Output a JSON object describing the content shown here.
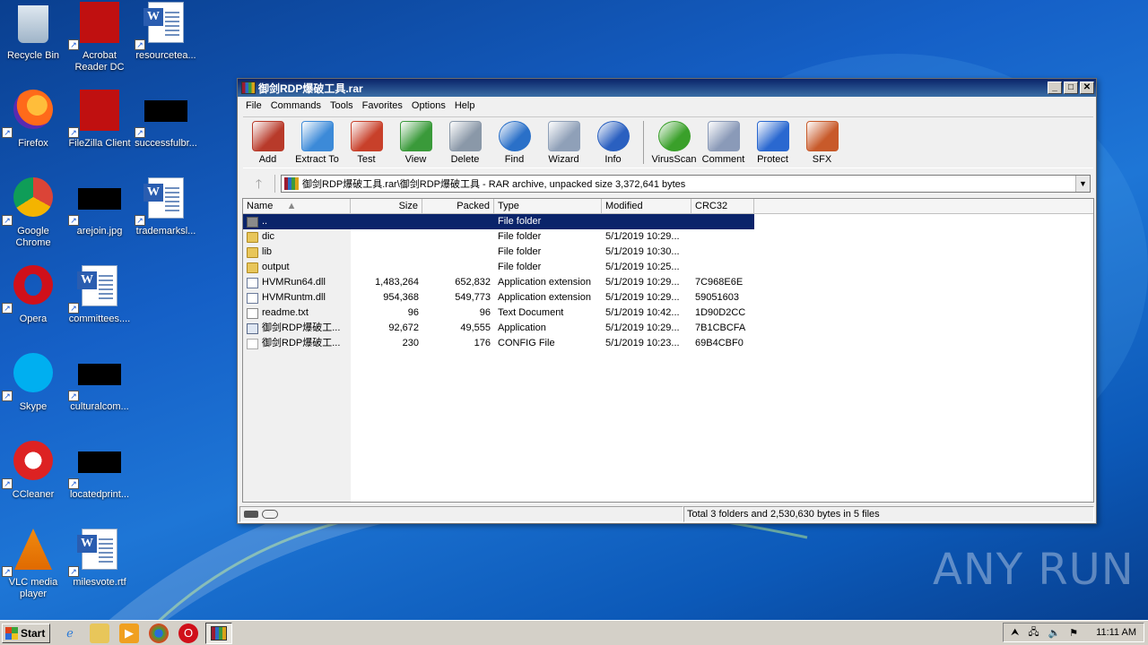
{
  "desktop": {
    "icons": [
      {
        "label": "Recycle Bin"
      },
      {
        "label": "Acrobat Reader DC"
      },
      {
        "label": "resourcetea..."
      },
      {
        "label": "Firefox"
      },
      {
        "label": "FileZilla Client"
      },
      {
        "label": "successfulbr..."
      },
      {
        "label": "Google Chrome"
      },
      {
        "label": "arejoin.jpg"
      },
      {
        "label": "trademarksl..."
      },
      {
        "label": "Opera"
      },
      {
        "label": "committees...."
      },
      {
        "label": "Skype"
      },
      {
        "label": "culturalcom..."
      },
      {
        "label": "CCleaner"
      },
      {
        "label": "locatedprint..."
      },
      {
        "label": "VLC media player"
      },
      {
        "label": "milesvote.rtf"
      }
    ],
    "watermark": "ANY RUN"
  },
  "window": {
    "title": "御剑RDP爆破工具.rar",
    "controls": {
      "min": "_",
      "max": "□",
      "close": "✕"
    },
    "menu": [
      "File",
      "Commands",
      "Tools",
      "Favorites",
      "Options",
      "Help"
    ],
    "toolbar": [
      {
        "label": "Add",
        "color": "#b83a2a"
      },
      {
        "label": "Extract To",
        "color": "#3c8ad8"
      },
      {
        "label": "Test",
        "color": "#c8402a"
      },
      {
        "label": "View",
        "color": "#3a9a3a"
      },
      {
        "label": "Delete",
        "color": "#8a98a8"
      },
      {
        "label": "Find",
        "color": "#2a70c8"
      },
      {
        "label": "Wizard",
        "color": "#8fa0b8"
      },
      {
        "label": "Info",
        "color": "#2a60c0"
      },
      {
        "label": "VirusScan",
        "color": "#3aa02a"
      },
      {
        "label": "Comment",
        "color": "#8a9ab8"
      },
      {
        "label": "Protect",
        "color": "#2a68d0"
      },
      {
        "label": "SFX",
        "color": "#c85a2a"
      }
    ],
    "address": "御剑RDP爆破工具.rar\\御剑RDP爆破工具 - RAR archive, unpacked size 3,372,641 bytes",
    "columns": {
      "name": "Name",
      "size": "Size",
      "packed": "Packed",
      "type": "Type",
      "modified": "Modified",
      "crc": "CRC32"
    },
    "files": [
      {
        "name": "..",
        "size": "",
        "packed": "",
        "type": "File folder",
        "modified": "",
        "crc": "",
        "icon": "up"
      },
      {
        "name": "dic",
        "size": "",
        "packed": "",
        "type": "File folder",
        "modified": "5/1/2019 10:29...",
        "crc": "",
        "icon": "folder"
      },
      {
        "name": "lib",
        "size": "",
        "packed": "",
        "type": "File folder",
        "modified": "5/1/2019 10:30...",
        "crc": "",
        "icon": "folder"
      },
      {
        "name": "output",
        "size": "",
        "packed": "",
        "type": "File folder",
        "modified": "5/1/2019 10:25...",
        "crc": "",
        "icon": "folder"
      },
      {
        "name": "HVMRun64.dll",
        "size": "1,483,264",
        "packed": "652,832",
        "type": "Application extension",
        "modified": "5/1/2019 10:29...",
        "crc": "7C968E6E",
        "icon": "dll"
      },
      {
        "name": "HVMRuntm.dll",
        "size": "954,368",
        "packed": "549,773",
        "type": "Application extension",
        "modified": "5/1/2019 10:29...",
        "crc": "59051603",
        "icon": "dll"
      },
      {
        "name": "readme.txt",
        "size": "96",
        "packed": "96",
        "type": "Text Document",
        "modified": "5/1/2019 10:42...",
        "crc": "1D90D2CC",
        "icon": "txt"
      },
      {
        "name": "御剑RDP爆破工...",
        "size": "92,672",
        "packed": "49,555",
        "type": "Application",
        "modified": "5/1/2019 10:29...",
        "crc": "7B1CBCFA",
        "icon": "exe"
      },
      {
        "name": "御剑RDP爆破工...",
        "size": "230",
        "packed": "176",
        "type": "CONFIG File",
        "modified": "5/1/2019 10:23...",
        "crc": "69B4CBF0",
        "icon": "cfg"
      }
    ],
    "status_total": "Total 3 folders and 2,530,630 bytes in 5 files"
  },
  "taskbar": {
    "start_label": "Start",
    "clock": "11:11 AM"
  }
}
